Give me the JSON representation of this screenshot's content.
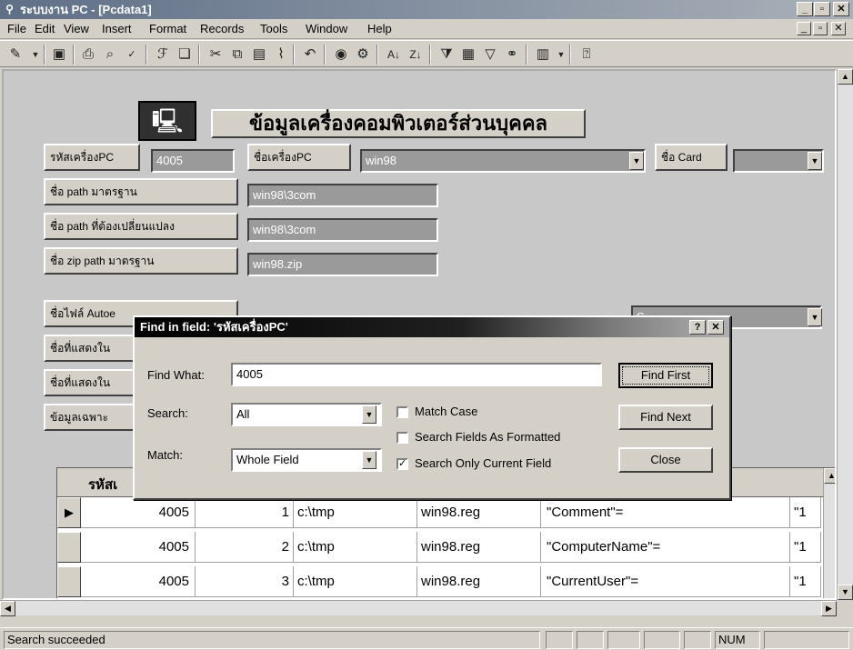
{
  "window": {
    "title": "ระบบงาน PC - [Pcdata1]",
    "min": "_",
    "max": "▫",
    "close": "✕"
  },
  "menu": {
    "items": [
      "File",
      "Edit",
      "View",
      "Insert",
      "Format",
      "Records",
      "Tools",
      "Window",
      "Help"
    ],
    "doc_min": "_",
    "doc_restore": "▫",
    "doc_close": "✕"
  },
  "toolbar": {
    "icons": [
      "design-view-icon",
      "save-icon",
      "print-icon",
      "print-preview-icon",
      "spelling-icon",
      "format-painter-icon",
      "book-icon",
      "cut-icon",
      "copy-icon",
      "paste-icon",
      "brush-icon",
      "undo-icon",
      "web-icon",
      "hyperlink-icon",
      "sort-ascending-icon",
      "sort-descending-icon",
      "filter-by-selection-icon",
      "filter-by-form-icon",
      "apply-filter-icon",
      "find-icon",
      "new-object-icon",
      "help-icon"
    ]
  },
  "form": {
    "title": "ข้อมูลเครื่องคอมพิวเตอร์ส่วนบุคคล",
    "row1": {
      "id_label": "รหัสเครื่องPC",
      "id_value": "4005",
      "name_label": "ชื่อเครื่องPC",
      "name_value": "win98",
      "card_label": "ชื่อ Card",
      "card_value": ""
    },
    "fields": [
      {
        "label": "ชื่อ path มาตรฐาน",
        "value": "win98\\3com"
      },
      {
        "label": "ชื่อ path ที่ต้องเปลี่ยนแปลง",
        "value": "win98\\3com"
      },
      {
        "label": "ชื่อ zip path มาตรฐาน",
        "value": "win98.zip"
      }
    ],
    "partial_labels": [
      "ชื่อไฟล์ Autoe",
      "ชื่อที่แสดงใน",
      "ชื่อที่แสดงใน",
      "ข้อมูลเฉพาะ"
    ],
    "partial_right_value": "S"
  },
  "grid": {
    "header_first": "รหัสเ",
    "rows": [
      {
        "selector": "▶",
        "id": "4005",
        "seq": "1",
        "path": "c:\\tmp",
        "file": "win98.reg",
        "key": "\"Comment\"=",
        "extra": "\"1"
      },
      {
        "selector": "",
        "id": "4005",
        "seq": "2",
        "path": "c:\\tmp",
        "file": "win98.reg",
        "key": "\"ComputerName\"=",
        "extra": "\"1"
      },
      {
        "selector": "",
        "id": "4005",
        "seq": "3",
        "path": "c:\\tmp",
        "file": "win98.reg",
        "key": "\"CurrentUser\"=",
        "extra": "\"1"
      }
    ]
  },
  "find_dialog": {
    "title": "Find in field: 'รหัสเครื่องPC'",
    "help": "?",
    "close_x": "✕",
    "find_what_label": "Find What:",
    "find_what_value": "4005",
    "search_label": "Search:",
    "search_value": "All",
    "match_label": "Match:",
    "match_value": "Whole Field",
    "match_case_label": "Match Case",
    "match_case_checked": false,
    "formatted_label": "Search Fields As Formatted",
    "formatted_checked": false,
    "current_field_label": "Search Only Current Field",
    "current_field_checked": true,
    "find_first_button": "Find First",
    "find_next_button": "Find Next",
    "close_button": "Close"
  },
  "status": {
    "message": "Search succeeded",
    "num": "NUM"
  }
}
